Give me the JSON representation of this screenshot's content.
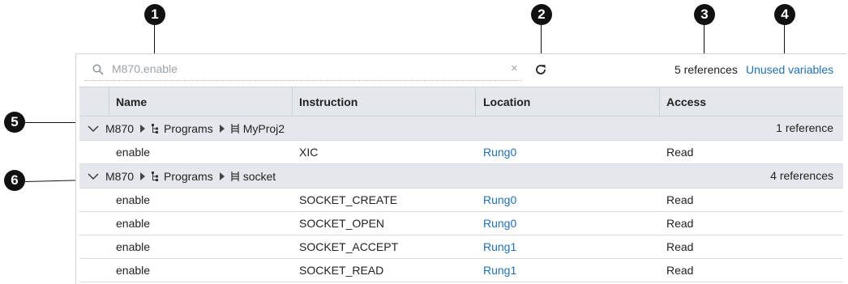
{
  "callouts": [
    "1",
    "2",
    "3",
    "4",
    "5",
    "6"
  ],
  "search": {
    "value": "M870.enable",
    "clear_glyph": "×"
  },
  "toolbar": {
    "reference_count": "5 references",
    "unused_label": "Unused variables"
  },
  "columns": [
    "Name",
    "Instruction",
    "Location",
    "Access"
  ],
  "groups": [
    {
      "controller": "M870",
      "programs": "Programs",
      "program": "MyProj2",
      "count": "1 reference",
      "rows": [
        {
          "name": "enable",
          "instruction": "XIC",
          "location": "Rung0",
          "access": "Read"
        }
      ]
    },
    {
      "controller": "M870",
      "programs": "Programs",
      "program": "socket",
      "count": "4 references",
      "rows": [
        {
          "name": "enable",
          "instruction": "SOCKET_CREATE",
          "location": "Rung0",
          "access": "Read"
        },
        {
          "name": "enable",
          "instruction": "SOCKET_OPEN",
          "location": "Rung0",
          "access": "Read"
        },
        {
          "name": "enable",
          "instruction": "SOCKET_ACCEPT",
          "location": "Rung1",
          "access": "Read"
        },
        {
          "name": "enable",
          "instruction": "SOCKET_READ",
          "location": "Rung1",
          "access": "Read"
        }
      ]
    }
  ],
  "colors": {
    "link": "#1f6fb5",
    "header_bg": "#e4e8ec",
    "callout": "#111111"
  }
}
